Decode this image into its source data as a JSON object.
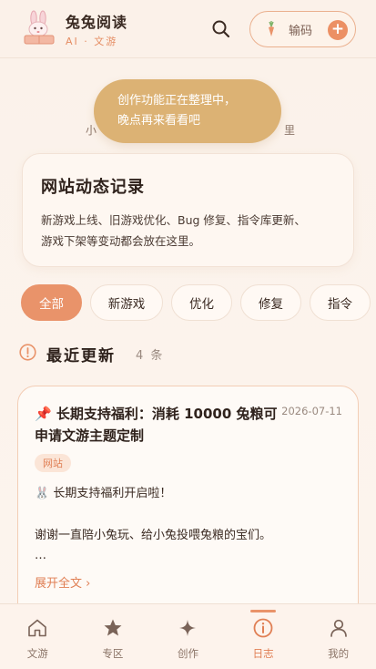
{
  "header": {
    "title": "兔兔阅读",
    "subtitle": "AI · 文游",
    "code_button_label": "输码",
    "code_plus": "+"
  },
  "behind_text": {
    "left": "小",
    "right": "里"
  },
  "toast": {
    "line1": "创作功能正在整理中，",
    "line2": "晚点再来看看吧"
  },
  "intro": {
    "title": "网站动态记录",
    "desc_line1": "新游戏上线、旧游戏优化、Bug 修复、指令库更新、",
    "desc_line2": "游戏下架等变动都会放在这里。"
  },
  "filters": [
    {
      "label": "全部",
      "active": true
    },
    {
      "label": "新游戏",
      "active": false
    },
    {
      "label": "优化",
      "active": false
    },
    {
      "label": "修复",
      "active": false
    },
    {
      "label": "指令",
      "active": false
    }
  ],
  "section": {
    "title": "最近更新",
    "count": "4 条"
  },
  "post": {
    "title": "📌 长期支持福利：消耗 10000 兔粮可申请文游主题定制",
    "date": "2026-07-11",
    "tag": "网站",
    "line1": "🐰 长期支持福利开启啦！",
    "line2": "谢谢一直陪小兔玩、给小兔投喂兔粮的宝们。",
    "ellipsis": "…",
    "more": "展开全文 ›"
  },
  "nav": [
    {
      "label": "文游",
      "icon": "home-icon",
      "active": false
    },
    {
      "label": "专区",
      "icon": "star-icon",
      "active": false
    },
    {
      "label": "创作",
      "icon": "sparkle-icon",
      "active": false
    },
    {
      "label": "日志",
      "icon": "info-icon",
      "active": true
    },
    {
      "label": "我的",
      "icon": "user-icon",
      "active": false
    }
  ],
  "colors": {
    "accent": "#e9936a",
    "toast": "#dcb274",
    "background": "#fbf1ea"
  }
}
